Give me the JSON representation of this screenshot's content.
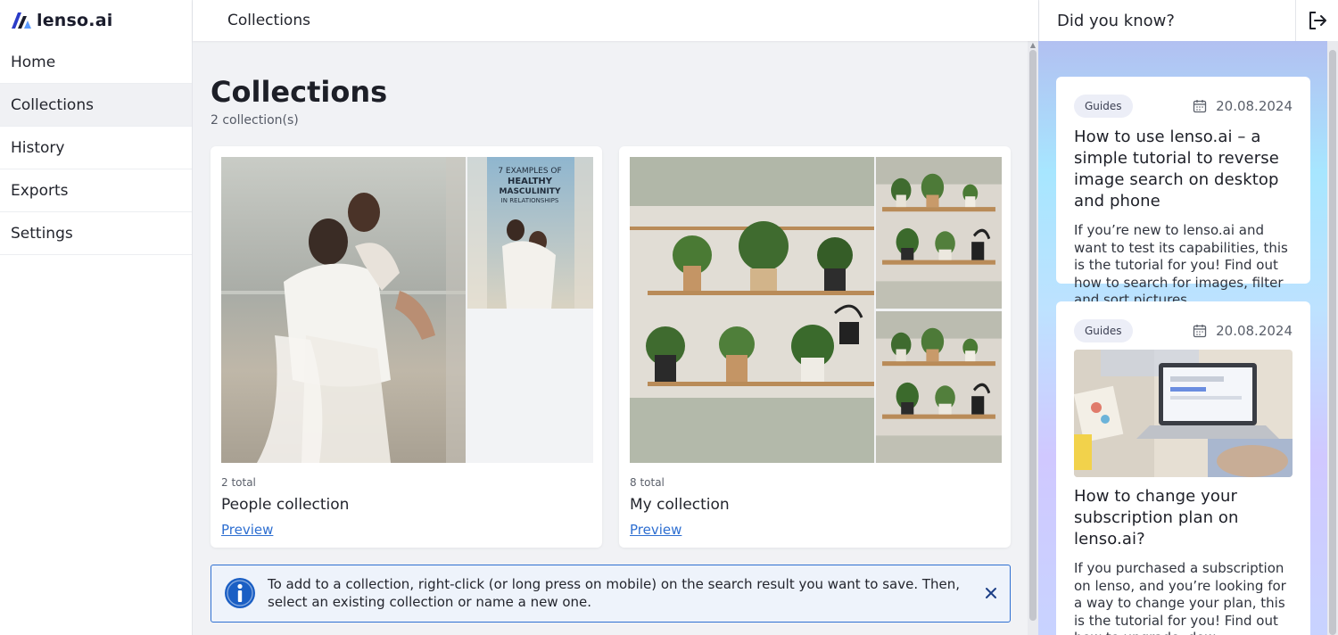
{
  "app": {
    "logo_text": "lenso.ai"
  },
  "sidebar": {
    "items": [
      {
        "label": "Home"
      },
      {
        "label": "Collections"
      },
      {
        "label": "History"
      },
      {
        "label": "Exports"
      },
      {
        "label": "Settings"
      }
    ],
    "active": "Collections"
  },
  "topbar": {
    "title": "Collections"
  },
  "page": {
    "title": "Collections",
    "count": "2 collection(s)"
  },
  "collections": [
    {
      "total": "2 total",
      "name": "People collection",
      "preview_label": "Preview",
      "thumb_text": "7 EXAMPLES OF HEALTHY MASCULINITY IN RELATIONSHIPS"
    },
    {
      "total": "8 total",
      "name": "My collection",
      "preview_label": "Preview"
    }
  ],
  "info_banner": {
    "text": "To add to a collection, right-click (or long press on mobile) on the search result you want to save. Then, select an existing collection or name a new one.",
    "icon": "info-icon",
    "close_icon": "close-icon"
  },
  "right_panel": {
    "title": "Did you know?",
    "logout_icon": "logout-icon",
    "articles": [
      {
        "badge": "Guides",
        "date": "20.08.2024",
        "title": "How to use lenso.ai – a simple tutorial to reverse image search on desktop and phone",
        "text": "If you’re new to lenso.ai and want to test its capabilities, this is the tutorial for you! Find out how to search for images, filter and sort pictures..."
      },
      {
        "badge": "Guides",
        "date": "20.08.2024",
        "title": "How to change your subscription plan on lenso.ai?",
        "text": "If you purchased a subscription on lenso, and you’re looking for a way to change your plan, this is the tutorial for you! Find out how to upgrade, dow..."
      }
    ]
  },
  "colors": {
    "accent": "#2e6fd1",
    "brand_dark": "#1a1c2c",
    "panel_gradient_start": "#b2c0f1"
  }
}
